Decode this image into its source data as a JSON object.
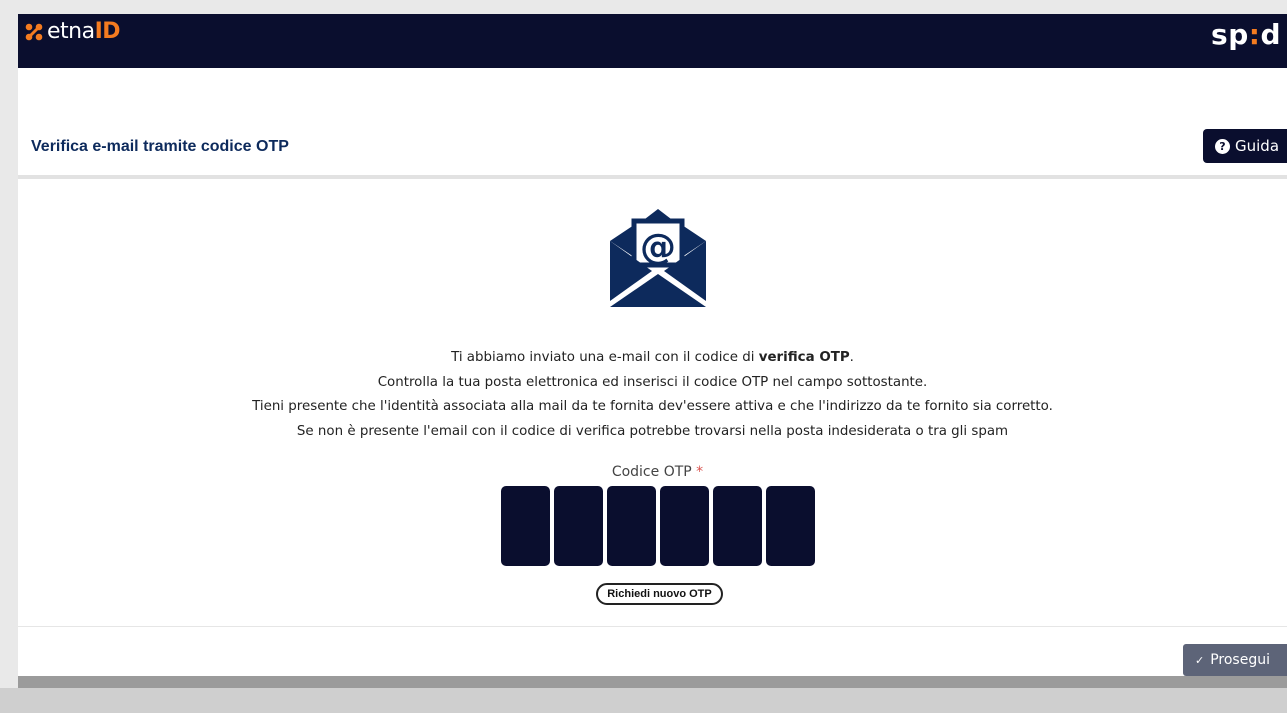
{
  "header": {
    "logo_left_text": "etna",
    "logo_left_highlight": "ID",
    "logo_right_prefix": "sp",
    "logo_right_dots": ":",
    "logo_right_suffix": "d"
  },
  "page": {
    "title": "Verifica e-mail tramite codice OTP",
    "help_button": "Guida"
  },
  "message": {
    "line1_prefix": "Ti abbiamo inviato una e-mail con il codice di ",
    "line1_bold": "verifica OTP",
    "line1_suffix": ".",
    "line2": "Controlla la tua posta elettronica ed inserisci il codice OTP nel campo sottostante.",
    "line3": "Tieni presente che l'identità associata alla mail da te fornita dev'essere attiva e che l'indirizzo da te fornito sia corretto.",
    "line4": "Se non è presente l'email con il codice di verifica potrebbe trovarsi nella posta indesiderata o tra gli spam"
  },
  "otp": {
    "label": "Codice OTP",
    "required_marker": "*",
    "digits": [
      "",
      "",
      "",
      "",
      "",
      ""
    ],
    "resend_button": "Richiedi nuovo OTP"
  },
  "footer": {
    "continue_button": "Prosegui"
  },
  "colors": {
    "navy": "#0a0e2e",
    "brand_orange": "#f47b20",
    "title_blue": "#0d2a5c",
    "continue_gray": "#5d6478"
  },
  "icons": {
    "help": "question-circle-icon",
    "mail": "envelope-at-icon",
    "check": "check-icon"
  }
}
